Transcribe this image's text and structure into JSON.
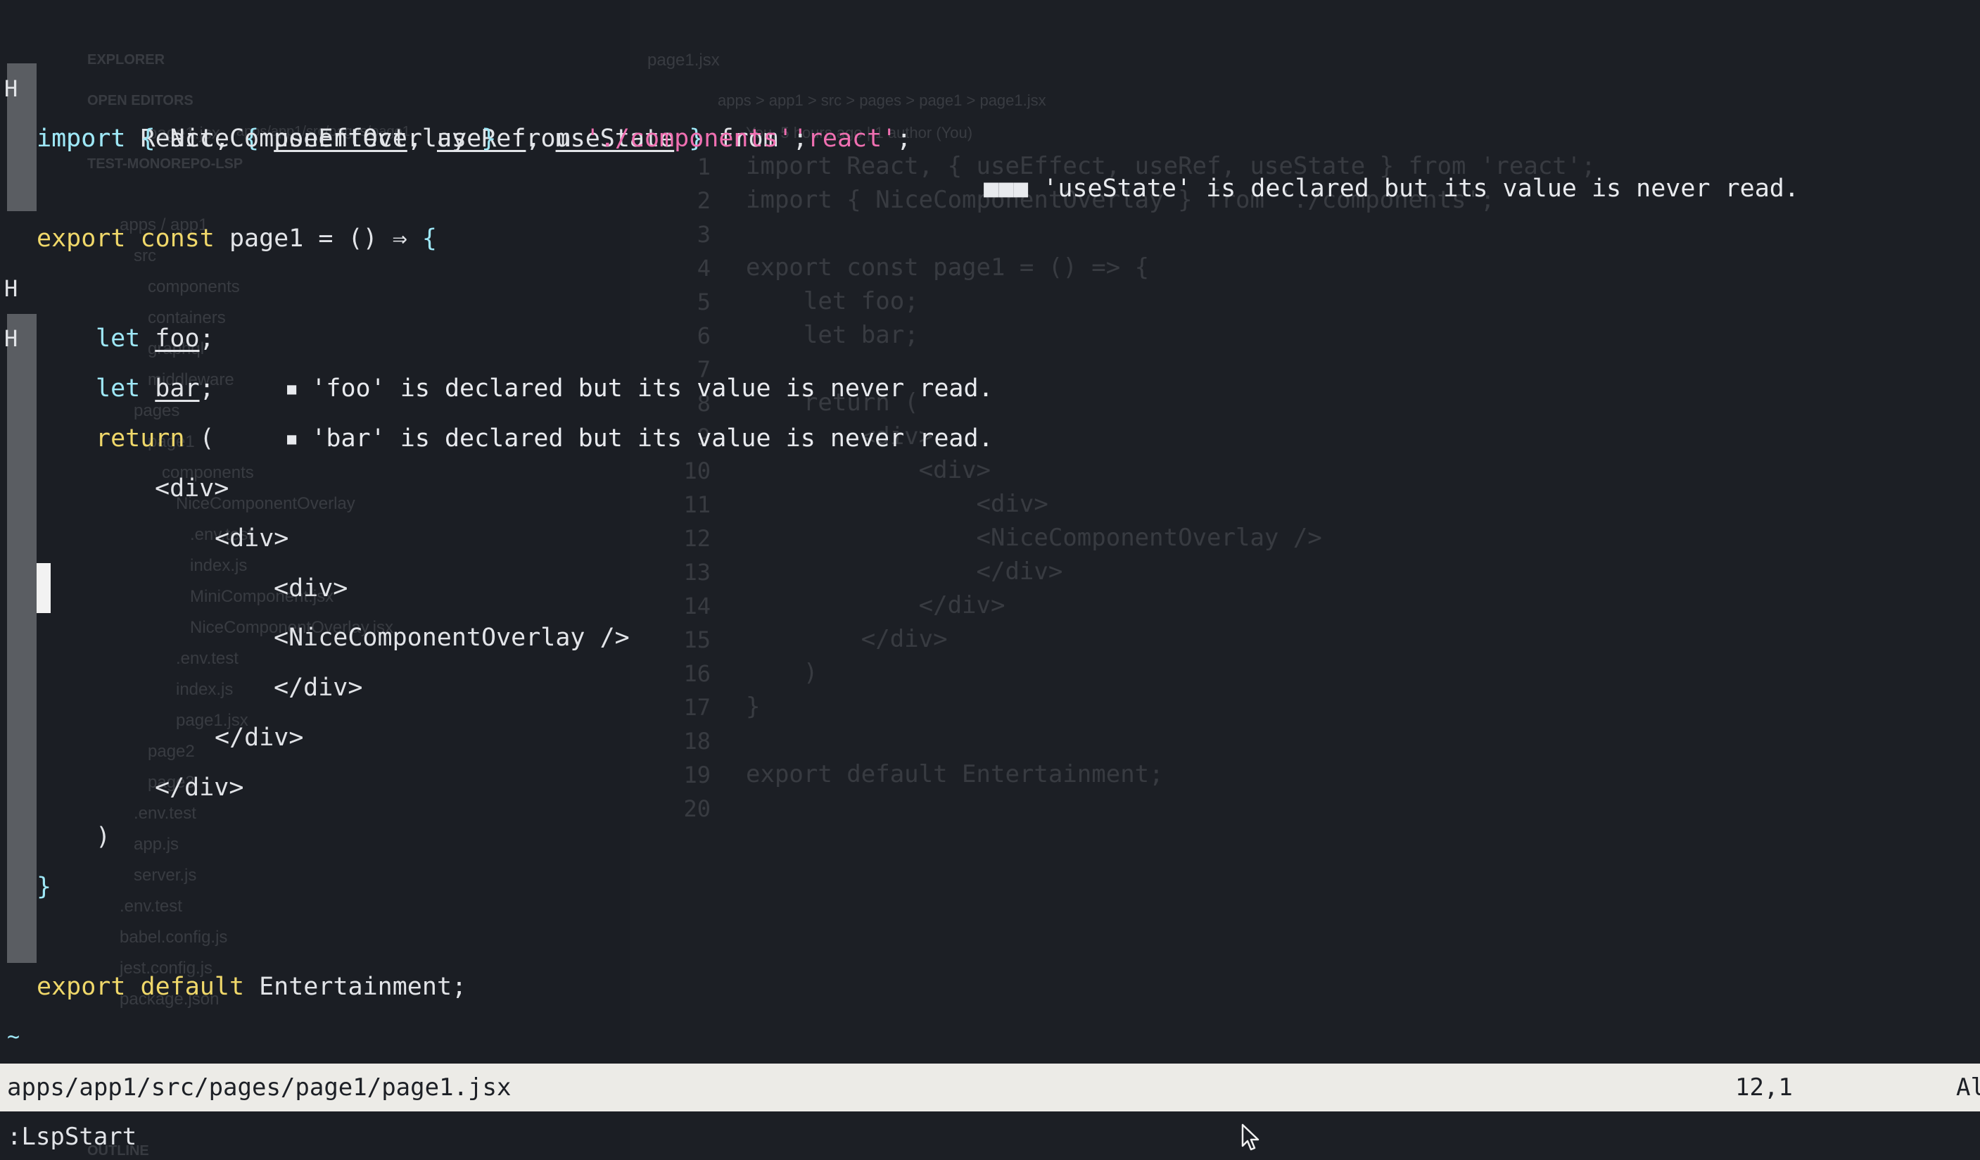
{
  "background_window": {
    "sidebar": {
      "explorer_title": "EXPLORER",
      "open_editors_heading": "OPEN EDITORS",
      "open_editor_item": "page1.jsx",
      "open_editor_path": "apps/app1/src/pages/page1",
      "workspace_heading": "TEST-MONOREPO-LSP",
      "tree": [
        "apps / app1",
        "src",
        "components",
        "containers",
        "graphql",
        "middleware",
        "pages",
        "page1",
        "components",
        "NiceComponentOverlay",
        ".env.test",
        "index.js",
        "MiniComponent.jsx",
        "NiceComponentOverlay.jsx",
        ".env.test",
        "index.js",
        "page1.jsx",
        "page2",
        "page3",
        ".env.test",
        "app.js",
        "server.js",
        ".env.test",
        "babel.config.js",
        "jest.config.js",
        "package.json"
      ],
      "outline_heading": "OUTLINE"
    },
    "tab_label": "page1.jsx",
    "breadcrumb": "apps > app1 > src > pages > page1 > page1.jsx",
    "blame": "You, 5 hours ago | 1 author (You)",
    "line_numbers": [
      "1",
      "2",
      "3",
      "4",
      "5",
      "6",
      "7",
      "8",
      "9",
      "10",
      "11",
      "12",
      "13",
      "14",
      "15",
      "16",
      "17",
      "18",
      "19",
      "20"
    ],
    "code_lines": [
      "import React, { useEffect, useRef, useState } from 'react';",
      "import { NiceComponentOverlay } from './components';",
      "",
      "export const page1 = () => {",
      "    let foo;",
      "    let bar;",
      "",
      "    return (",
      "        <div>",
      "            <div>",
      "                <div>",
      "                <NiceComponentOverlay />",
      "                </div>",
      "            </div>",
      "        </div>",
      "    )",
      "}",
      "",
      "export default Entertainment;",
      ""
    ]
  },
  "editor": {
    "signs": {
      "hint": "H"
    },
    "line1": {
      "import_kw": "import",
      "react": " React, ",
      "brace_open": "{",
      "use_effect": "useEffect",
      "comma1": ", ",
      "use_ref": "useRef",
      "comma2": ", ",
      "use_state": "useState",
      "brace_close": "}",
      "from_kw": " from ",
      "module": "'react'",
      "semi": ";",
      "diag_marker": "■■■",
      "diag_text": " 'useState' is declared but its value is never read."
    },
    "line2": {
      "import_kw": "import",
      "brace_open": " {",
      "name": " NiceComponentOverlay ",
      "brace_close": "}",
      "from_kw": " from ",
      "module": "'./components'",
      "semi": ";"
    },
    "line4": {
      "export_kw": "export",
      "const_kw": " const",
      "rest": " page1 = () ⇒ ",
      "brace": "{"
    },
    "line5": {
      "let_kw": "let",
      "space": " ",
      "name": "foo",
      "semi": ";",
      "diag_marker": "■",
      "diag_text": " 'foo' is declared but its value is never read."
    },
    "line6": {
      "let_kw": "let",
      "space": " ",
      "name": "bar",
      "semi": ";",
      "diag_marker": "■",
      "diag_text": " 'bar' is declared but its value is never read."
    },
    "line8": {
      "return_kw": "return",
      "paren": " ("
    },
    "line9": {
      "text": "<div>"
    },
    "line10": {
      "text": "<div>"
    },
    "line11": {
      "text": "<div>"
    },
    "line12": {
      "text": "<NiceComponentOverlay />"
    },
    "line13": {
      "text": "</div>"
    },
    "line14": {
      "text": "</div>"
    },
    "line15": {
      "text": "</div>"
    },
    "line16": {
      "text": ")"
    },
    "line17": {
      "text": "}"
    },
    "line19": {
      "export_kw": "export",
      "default_kw": " default",
      "rest": " Entertainment;"
    },
    "tilde": "~"
  },
  "statusline": {
    "path": "apps/app1/src/pages/page1/page1.jsx",
    "position": "12,1",
    "scroll": "All"
  },
  "cmdline": ":LspStart"
}
